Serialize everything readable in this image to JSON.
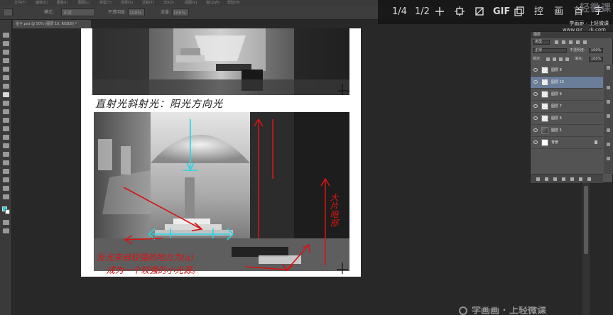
{
  "app": {
    "name": "Photoshop"
  },
  "menubar": {
    "items": [
      "文件(F)",
      "编辑(E)",
      "图像(I)",
      "图层(L)",
      "类型(Y)",
      "选择(S)",
      "滤镜(T)",
      "3D(D)",
      "视图(V)",
      "窗口(W)",
      "帮助(H)"
    ]
  },
  "options_bar": {
    "mode_label": "模式:",
    "mode_value": "正常",
    "opacity_label": "不透明度:",
    "opacity_value": "100%",
    "flow_label": "流量:",
    "flow_value": "100%"
  },
  "overlay_toolbar": {
    "buttons": [
      "1/4",
      "1/2",
      "⊹",
      "⊡",
      "⊠",
      "GIF",
      "❐",
      "控",
      "画",
      "首",
      "字"
    ],
    "watermark_brand": "轻微课",
    "watermark_subtitle": "学画画 · 上轻微课",
    "watermark_url": "www.qingwk.com"
  },
  "document": {
    "tab_title": "屋子.psd @ 50% (图层 10, RGB/8) *",
    "caption_black": "直射光斜射光：阳光方向光",
    "caption_red_1": "反光来自较强的地方为(a)",
    "caption_red_2": "成为一个较强的小光源。",
    "caption_red_side": "大片暗部"
  },
  "layers_panel": {
    "tab_label": "图层",
    "filter_kind": "类型",
    "blend_mode": "正常",
    "opacity_label": "不透明度:",
    "opacity_value": "100%",
    "lock_label": "锁定:",
    "fill_label": "填充:",
    "fill_value": "100%",
    "layers": [
      {
        "name": "图层 8",
        "thumb": "transparent",
        "selected": false
      },
      {
        "name": "图层 10",
        "thumb": "transparent",
        "selected": true
      },
      {
        "name": "图层 9",
        "thumb": "transparent",
        "selected": false
      },
      {
        "name": "图层 7",
        "thumb": "transparent",
        "selected": false
      },
      {
        "name": "图层 6",
        "thumb": "transparent",
        "selected": false
      },
      {
        "name": "图层 5",
        "thumb": "image",
        "selected": false
      },
      {
        "name": "背景",
        "thumb": "white",
        "selected": false,
        "locked": true
      }
    ]
  },
  "watermark_bottom": {
    "text": "学画画 · 上轻微课"
  },
  "colors": {
    "foreground": "#1fd5e0",
    "background": "#ffffff",
    "annotation_red": "#d61414",
    "annotation_cyan": "#22d6e6",
    "selected_layer": "#6a7d99"
  }
}
